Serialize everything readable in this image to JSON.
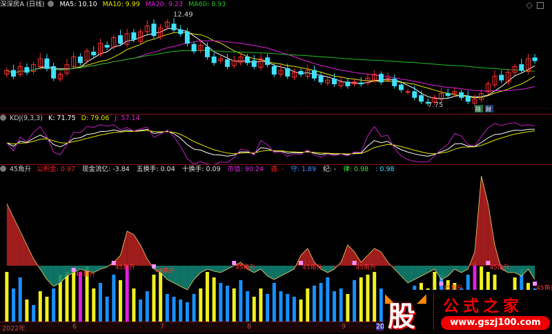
{
  "main": {
    "title": "深深房A (日线)",
    "ma5": "MA5: 10.10",
    "ma10": "MA10: 9.99",
    "ma20": "MA20: 9.23",
    "ma60": "MA60: 8.93",
    "high_label": "12.49",
    "low_label": "7.75",
    "badge1": "除",
    "badge2": "财",
    "colors": {
      "ma5": "#ffffff",
      "ma10": "#e6e600",
      "ma20": "#e020e0",
      "ma60": "#20c020",
      "up": "#ff3030",
      "down": "#40e0ff"
    },
    "closes": [
      9.6,
      9.3,
      9.8,
      9.5,
      9.9,
      10.2,
      9.7,
      9.2,
      9.4,
      9.9,
      10.3,
      10.0,
      10.6,
      10.4,
      11.0,
      10.8,
      11.3,
      11.0,
      11.5,
      11.2,
      11.6,
      11.9,
      11.4,
      11.8,
      12.1,
      11.7,
      11.5,
      11.0,
      10.6,
      10.9,
      10.3,
      10.0,
      10.2,
      9.8,
      10.1,
      10.3,
      10.0,
      9.8,
      10.2,
      9.9,
      9.4,
      9.6,
      9.3,
      9.5,
      9.4,
      9.6,
      9.2,
      9.0,
      9.1,
      8.9,
      9.0,
      8.8,
      9.0,
      8.9,
      9.2,
      9.4,
      9.0,
      9.2,
      8.8,
      8.6,
      8.5,
      8.2,
      8.0,
      7.9,
      8.2,
      8.4,
      8.3,
      8.5,
      8.2,
      8.0,
      8.1,
      8.4,
      8.9,
      9.3,
      9.1,
      9.5,
      9.8,
      9.6,
      10.2,
      10.1
    ],
    "price_range": [
      7.6,
      12.6
    ]
  },
  "kdj": {
    "title": "KDJ(9,3,3)",
    "k": "K: 71.75",
    "d": "D: 79.06",
    "j": "J: 57.14"
  },
  "ind": {
    "title": "45角升",
    "items": [
      {
        "label": "公积金",
        "value": ": 0.97",
        "lc": "#ff2020",
        "vc": "#ff2020"
      },
      {
        "label": "现金流亿",
        "value": ": -3.84",
        "lc": "#e0e0e0",
        "vc": "#e0e0e0"
      },
      {
        "label": "五换手",
        "value": ": 0.04",
        "lc": "#e0e0e0",
        "vc": "#e0e0e0"
      },
      {
        "label": "十换手",
        "value": ": 0.09",
        "lc": "#e0e0e0",
        "vc": "#e0e0e0"
      },
      {
        "label": "市值",
        "value": ": 90.24",
        "lc": "#e020e0",
        "vc": "#e020e0"
      },
      {
        "label": "遇",
        "value": ": -",
        "lc": "#ff2020",
        "vc": "#ff2020"
      },
      {
        "label": "守",
        "value": ": 1.89",
        "lc": "#4090ff",
        "vc": "#4090ff"
      },
      {
        "label": "纪",
        "value": ": -",
        "lc": "#e0e0e0",
        "vc": "#e0e0e0"
      },
      {
        "label": "律",
        "value": ": 0.98",
        "lc": "#40e040",
        "vc": "#40e040"
      },
      {
        "label": "",
        "value": ": 0.98",
        "lc": "#40e0ff",
        "vc": "#40e0ff"
      }
    ],
    "signal_label": "45角升",
    "signal_indices": [
      10,
      16,
      22,
      34,
      44,
      52,
      65,
      72,
      79
    ],
    "osc": [
      90,
      70,
      50,
      30,
      10,
      -5,
      -20,
      -30,
      -25,
      -15,
      -10,
      -5,
      -8,
      -10,
      -5,
      -2,
      5,
      15,
      50,
      45,
      30,
      10,
      -5,
      -10,
      -20,
      -25,
      -30,
      -35,
      -20,
      -10,
      -5,
      -8,
      -10,
      -5,
      0,
      5,
      -5,
      -10,
      -5,
      -15,
      -20,
      -15,
      -10,
      -5,
      15,
      25,
      5,
      -5,
      -10,
      -5,
      5,
      30,
      20,
      5,
      15,
      25,
      20,
      5,
      -5,
      -15,
      -25,
      -20,
      -15,
      -10,
      -5,
      -20,
      -15,
      -5,
      -10,
      -5,
      20,
      130,
      90,
      30,
      -5,
      -10,
      -10,
      -15,
      -5,
      -20
    ],
    "bars": [
      90,
      60,
      80,
      40,
      30,
      55,
      45,
      60,
      85,
      90,
      95,
      80,
      100,
      60,
      70,
      45,
      85,
      75,
      90,
      60,
      40,
      55,
      85,
      95,
      50,
      45,
      40,
      35,
      50,
      60,
      90,
      80,
      70,
      65,
      60,
      75,
      55,
      45,
      60,
      50,
      70,
      55,
      50,
      45,
      40,
      60,
      65,
      70,
      80,
      55,
      60,
      50,
      75,
      80,
      85,
      90,
      60,
      55,
      45,
      40,
      55,
      65,
      70,
      60,
      90,
      85,
      75,
      70,
      60,
      85,
      95,
      100,
      90,
      85,
      55,
      50,
      80,
      95,
      70,
      60
    ],
    "bar_types": "ybbybyybyyymyybbbymybbyybbbbbyyybbybbyybbbbbyybbbbbybyyybbbbbbyyybyybbmyyybbyby",
    "colors": {
      "red_area": "#b02020",
      "green_area": "#108070",
      "yellow": "#f0f020",
      "blue": "#1890ff",
      "magenta": "#e020e0",
      "signal": "#ff3030"
    }
  },
  "axis": {
    "labels": [
      "2022年",
      "6",
      "7",
      "8",
      "9",
      "20"
    ]
  },
  "logo": {
    "char": "股",
    "title": "公式之家",
    "url": "www.gszj100.com"
  }
}
